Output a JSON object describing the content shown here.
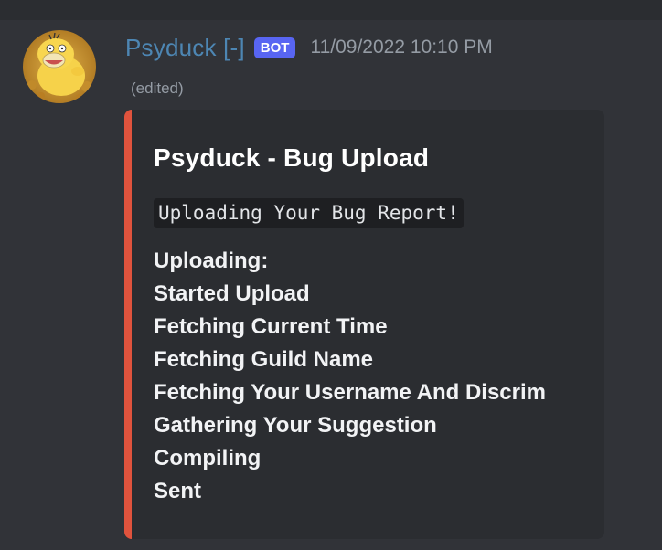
{
  "message": {
    "author": "Psyduck [-]",
    "badge": "BOT",
    "timestamp": "11/09/2022 10:10 PM",
    "edited": "(edited)"
  },
  "embed": {
    "accent_color": "#e0533d",
    "title": "Psyduck - Bug Upload",
    "code_text": "Uploading Your Bug Report!",
    "lines": [
      "Uploading:",
      "Started Upload",
      "Fetching Current Time",
      "Fetching Guild Name",
      "Fetching Your Username And Discrim",
      "Gathering Your Suggestion",
      "Compiling",
      "Sent"
    ]
  },
  "colors": {
    "background": "#313338",
    "embed_background": "#2b2d31",
    "username": "#4d86b3",
    "badge": "#5865f2",
    "muted_text": "#949ba4"
  }
}
